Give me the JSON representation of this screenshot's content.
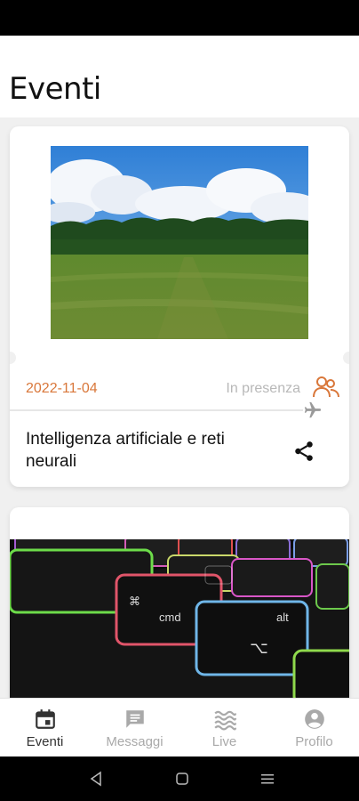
{
  "header": {
    "title": "Eventi"
  },
  "events": [
    {
      "date": "2022-11-04",
      "mode": "In presenza",
      "title": "Intelligenza artificiale e reti neurali",
      "image": "meadow-forest-photo"
    },
    {
      "image": "keyboard-photo"
    }
  ],
  "nav": {
    "items": [
      {
        "label": "Eventi",
        "icon": "calendar-icon",
        "active": true
      },
      {
        "label": "Messaggi",
        "icon": "chat-icon",
        "active": false
      },
      {
        "label": "Live",
        "icon": "waves-icon",
        "active": false
      },
      {
        "label": "Profilo",
        "icon": "account-icon",
        "active": false
      }
    ]
  },
  "colors": {
    "accent": "#d9773a",
    "inactive": "#a9a9a9",
    "active": "#333333"
  }
}
